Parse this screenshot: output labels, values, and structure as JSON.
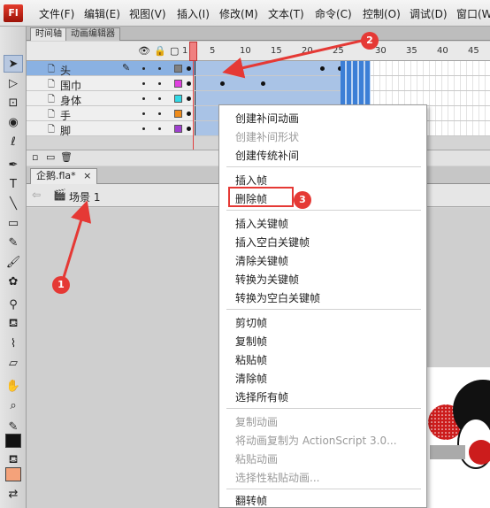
{
  "app": {
    "logo": "Fl"
  },
  "menubar": {
    "items": [
      "文件(F)",
      "编辑(E)",
      "视图(V)",
      "插入(I)",
      "修改(M)",
      "文本(T)",
      "命令(C)",
      "控制(O)",
      "调试(D)",
      "窗口(W)"
    ]
  },
  "timeline": {
    "tabs": [
      "时间轴",
      "动画编辑器"
    ],
    "ruler": [
      "1",
      "5",
      "10",
      "15",
      "20",
      "25",
      "30",
      "35",
      "40",
      "45"
    ],
    "layers": [
      {
        "name": "头",
        "color": "#808080",
        "selected": true
      },
      {
        "name": "围巾",
        "color": "#e040e0",
        "selected": false
      },
      {
        "name": "身体",
        "color": "#32d9e6",
        "selected": false
      },
      {
        "name": "手",
        "color": "#f08c1a",
        "selected": false
      },
      {
        "name": "脚",
        "color": "#a040d0",
        "selected": false
      }
    ]
  },
  "document": {
    "tab": "企鹅.fla*",
    "close": "×",
    "scene": "场景 1"
  },
  "context_menu": {
    "items": [
      {
        "label": "创建补间动画",
        "enabled": true
      },
      {
        "label": "创建补间形状",
        "enabled": false
      },
      {
        "label": "创建传统补间",
        "enabled": true
      },
      {
        "label": "插入帧",
        "enabled": true
      },
      {
        "label": "删除帧",
        "enabled": true,
        "highlighted": true
      },
      {
        "label": "插入关键帧",
        "enabled": true
      },
      {
        "label": "插入空白关键帧",
        "enabled": true
      },
      {
        "label": "清除关键帧",
        "enabled": true
      },
      {
        "label": "转换为关键帧",
        "enabled": true
      },
      {
        "label": "转换为空白关键帧",
        "enabled": true
      },
      {
        "label": "剪切帧",
        "enabled": true
      },
      {
        "label": "复制帧",
        "enabled": true
      },
      {
        "label": "粘贴帧",
        "enabled": true
      },
      {
        "label": "清除帧",
        "enabled": true
      },
      {
        "label": "选择所有帧",
        "enabled": true
      },
      {
        "label": "复制动画",
        "enabled": false
      },
      {
        "label": "将动画复制为 ActionScript 3.0...",
        "enabled": false
      },
      {
        "label": "粘贴动画",
        "enabled": false
      },
      {
        "label": "选择性粘贴动画...",
        "enabled": false
      },
      {
        "label": "翻转帧",
        "enabled": true
      }
    ]
  },
  "annotations": {
    "badges": [
      "1",
      "2",
      "3"
    ],
    "color": "#e53935"
  }
}
